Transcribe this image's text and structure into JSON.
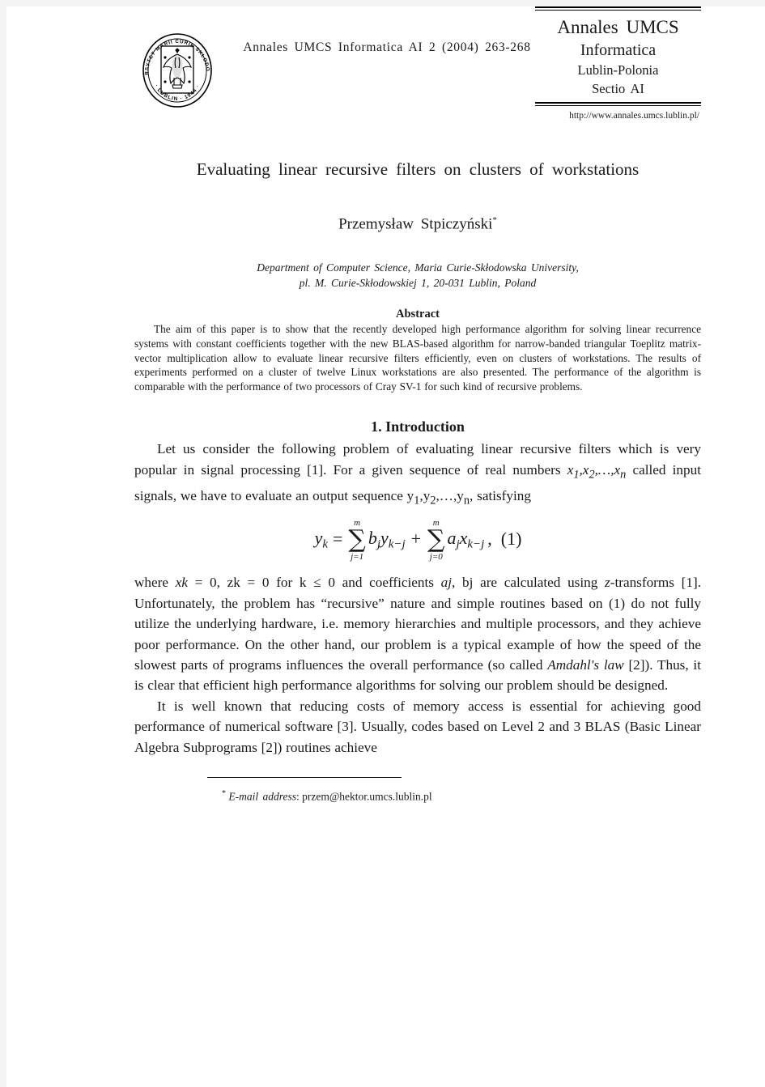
{
  "page": {
    "background_color": "#f4f4f4",
    "sheet_color": "#ffffff"
  },
  "masthead": {
    "seal_text_outer": "UNIWERSYTET MARII CURIE SKŁODOWSKIEJ",
    "seal_text_lower": "· LUBLIN · 1944 ·",
    "journal_reference": "Annales UMCS Informatica AI 2 (2004) 263-268",
    "box": {
      "line1": "Annales UMCS",
      "line2": "Informatica",
      "line3": "Lublin-Polonia",
      "line4": "Sectio AI"
    },
    "url": "http://www.annales.umcs.lublin.pl/"
  },
  "title": "Evaluating linear recursive filters on clusters of workstations",
  "author": {
    "name": "Przemysław Stpiczyński",
    "footnote_marker": "*"
  },
  "affiliation": {
    "line1": "Department of Computer Science, Maria Curie-Skłodowska University,",
    "line2": "pl. M. Curie-Skłodowskiej 1, 20-031 Lublin, Poland"
  },
  "abstract": {
    "heading": "Abstract",
    "body": "The aim of this paper is to show that the recently developed high performance algorithm for solving linear recurrence systems with constant coefficients together with the new BLAS-based algorithm for narrow-banded triangular Toeplitz matrix-vector multiplication allow to evaluate linear recursive filters efficiently, even on clusters of workstations. The results of experiments performed on a cluster of twelve Linux workstations are also presented. The performance of the algorithm is comparable with the performance of two processors of Cray SV-1 for such kind of recursive problems."
  },
  "sections": [
    {
      "heading": "1. Introduction",
      "paragraph_1_part_1": "Let us consider the following problem of evaluating linear recursive filters which is very popular in signal processing [1]. For a given sequence of real numbers ",
      "paragraph_1_seq_x": "x1,x2,…,xn",
      "paragraph_1_part_2": " called input signals, we have to evaluate an output sequence ",
      "paragraph_1_seq_y": "y1,y2,…,yn,",
      "paragraph_1_part_3": " satisfying",
      "paragraph_2_part_1": "where ",
      "paragraph_2_xk": "xk",
      "paragraph_2_part_2": " = 0, ",
      "paragraph_2_zk": "zk",
      "paragraph_2_part_3": " = 0 for k ≤ 0 and coefficients ",
      "paragraph_2_aj": "aj",
      "paragraph_2_part_4": ", ",
      "paragraph_2_bj": "bj",
      "paragraph_2_part_5": " are calculated using ",
      "paragraph_2_z": "z",
      "paragraph_2_part_6": "-transforms [1]. Unfortunately, the problem has “recursive” nature and simple routines based on (1) do not fully utilize the underlying hardware, i.e. memory hierarchies and multiple processors, and they achieve poor performance. On the other hand, our problem is a typical example of how the speed of the slowest parts of programs influences the overall performance (so called ",
      "paragraph_2_amdahl": "Amdahl's law",
      "paragraph_2_part_7": " [2]). Thus, it is clear that efficient high performance algorithms for solving our problem should be designed.",
      "paragraph_3": "It is well known that reducing costs of memory access is essential for achieving good performance of numerical software [3]. Usually, codes based on Level 2 and 3 BLAS (Basic Linear Algebra Subprograms [2]) routines achieve"
    }
  ],
  "equation": {
    "number": "(1)",
    "lhs": "y",
    "lhs_sub": "k",
    "eq_sign": "=",
    "sum1": {
      "upper": "m",
      "lower": "j=1",
      "coef": "b",
      "coef_sub": "j",
      "var": "y",
      "var_sub": "k−j"
    },
    "plus": "+",
    "sum2": {
      "upper": "m",
      "lower": "j=0",
      "coef": "a",
      "coef_sub": "j",
      "var": "x",
      "var_sub": "k−j"
    },
    "comma": ","
  },
  "footnote": {
    "marker": "*",
    "label": "E-mail address",
    "separator": ": ",
    "value": "przem@hektor.umcs.lublin.pl"
  }
}
